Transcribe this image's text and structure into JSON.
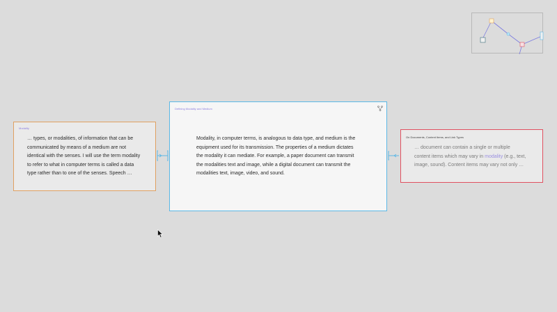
{
  "cards": {
    "left": {
      "title": "Modality",
      "lines": [
        "… types, or modalities, of information that can be",
        "communicated by means of a medium are not",
        "identical with the senses. I will use the term modality",
        "to refer to what in computer terms is called a data",
        "type rather than to one of the senses. Speech …"
      ],
      "border_color": "#e0a060"
    },
    "center": {
      "title": "Defining Modality and Medium",
      "lines": [
        "Modality, in computer terms, is analogous to data type, and medium is the",
        "equipment used for its transmission. The properties of a medium dictates",
        "the modality it can mediate. For example, a paper document can transmit",
        "the modalities text and image, while a digital document can transmit the",
        "modalities text, image, video, and sound."
      ],
      "border_color": "#5bb8e6"
    },
    "right": {
      "title": "On Documents, Content Items, and Link Types",
      "line1": "… document can contain a single or multiple",
      "line2_before": "content items which may vary in ",
      "line2_link": "modality",
      "line2_after": " (e.g., text,",
      "line3": "image, sound). Content items may vary not only …",
      "border_color": "#e05060"
    }
  },
  "icons": {
    "center_card_icon": "tree-structure-icon",
    "cursor": "mouse-pointer-icon"
  },
  "colors": {
    "background": "#dcdcdc",
    "link": "#9a8fe0",
    "title": "#8d7fe0"
  }
}
